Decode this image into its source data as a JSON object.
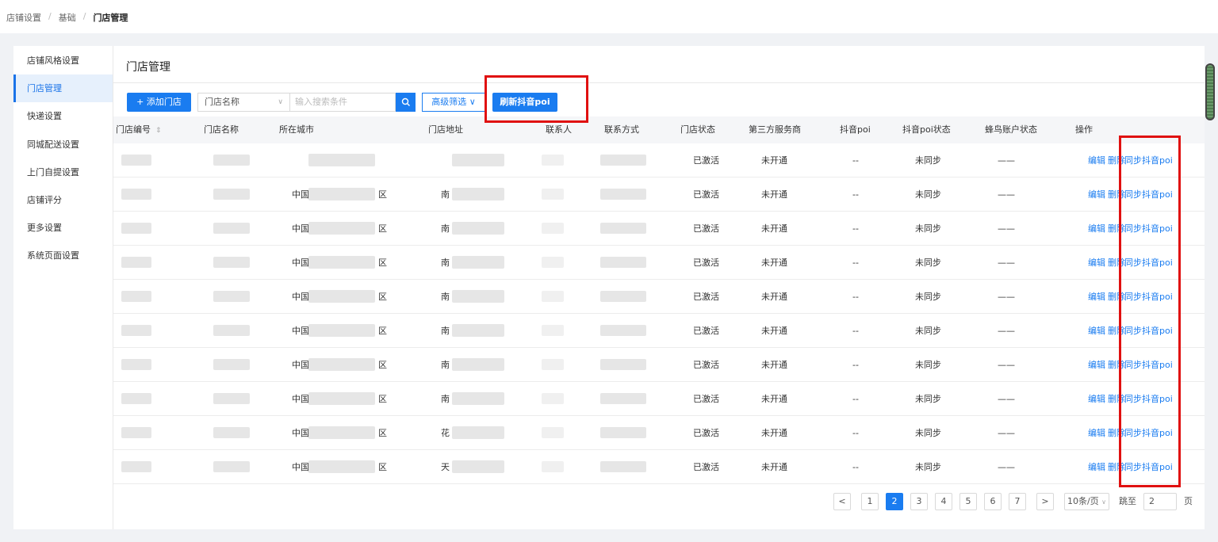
{
  "breadcrumb": [
    "店铺设置",
    "基础",
    "门店管理"
  ],
  "sidebar": {
    "items": [
      {
        "label": "店铺风格设置"
      },
      {
        "label": "门店管理",
        "active": true
      },
      {
        "label": "快递设置"
      },
      {
        "label": "同城配送设置"
      },
      {
        "label": "上门自提设置"
      },
      {
        "label": "店铺评分"
      },
      {
        "label": "更多设置"
      },
      {
        "label": "系统页面设置"
      }
    ]
  },
  "page": {
    "title": "门店管理"
  },
  "toolbar": {
    "add_label": "+ 添加门店",
    "search_field": "门店名称",
    "search_placeholder": "输入搜索条件",
    "advanced_filter": "高级筛选 ∨",
    "refresh_label": "刷新抖音poi"
  },
  "table": {
    "columns": [
      "门店编号",
      "门店名称",
      "所在城市",
      "门店地址",
      "联系人",
      "联系方式",
      "门店状态",
      "第三方服务商",
      "抖音poi",
      "抖音poi状态",
      "蜂鸟账户状态",
      "操作"
    ],
    "rows": [
      {
        "city": "",
        "city_end": "",
        "addr": "",
        "status": "已激活",
        "provider": "未开通",
        "poi": "--",
        "poi_status": "未同步",
        "fn_status": "——"
      },
      {
        "city": "中国",
        "city_end": "区",
        "addr": "南",
        "status": "已激活",
        "provider": "未开通",
        "poi": "--",
        "poi_status": "未同步",
        "fn_status": "——"
      },
      {
        "city": "中国",
        "city_end": "区",
        "addr": "南",
        "status": "已激活",
        "provider": "未开通",
        "poi": "--",
        "poi_status": "未同步",
        "fn_status": "——"
      },
      {
        "city": "中国",
        "city_end": "区",
        "addr": "南",
        "status": "已激活",
        "provider": "未开通",
        "poi": "--",
        "poi_status": "未同步",
        "fn_status": "——"
      },
      {
        "city": "中国",
        "city_end": "区",
        "addr": "南",
        "status": "已激活",
        "provider": "未开通",
        "poi": "--",
        "poi_status": "未同步",
        "fn_status": "——"
      },
      {
        "city": "中国",
        "city_end": "区",
        "addr": "南",
        "status": "已激活",
        "provider": "未开通",
        "poi": "--",
        "poi_status": "未同步",
        "fn_status": "——"
      },
      {
        "city": "中国",
        "city_end": "区",
        "addr": "南",
        "status": "已激活",
        "provider": "未开通",
        "poi": "--",
        "poi_status": "未同步",
        "fn_status": "——"
      },
      {
        "city": "中国",
        "city_end": "区",
        "addr": "南",
        "status": "已激活",
        "provider": "未开通",
        "poi": "--",
        "poi_status": "未同步",
        "fn_status": "——"
      },
      {
        "city": "中国",
        "city_end": "区",
        "addr": "花",
        "status": "已激活",
        "provider": "未开通",
        "poi": "--",
        "poi_status": "未同步",
        "fn_status": "——"
      },
      {
        "city": "中国",
        "city_end": "区",
        "addr": "天",
        "status": "已激活",
        "provider": "未开通",
        "poi": "--",
        "poi_status": "未同步",
        "fn_status": "——"
      }
    ],
    "actions": {
      "edit": "编辑",
      "delete": "删除",
      "sync": "同步抖音poi"
    }
  },
  "pagination": {
    "prev": "<",
    "next": ">",
    "pages": [
      "1",
      "2",
      "3",
      "4",
      "5",
      "6",
      "7"
    ],
    "current": "2",
    "page_size": "10条/页",
    "goto_label": "跳至",
    "goto_value": "2",
    "page_suffix": "页"
  },
  "colors": {
    "accent": "#1a7cf0",
    "highlight": "#e01010"
  }
}
